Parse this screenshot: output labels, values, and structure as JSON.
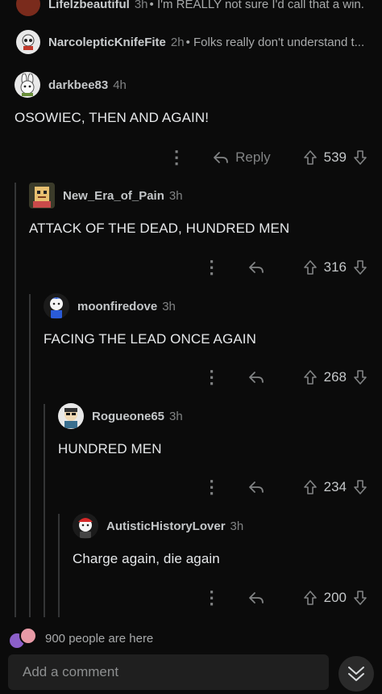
{
  "collapsed": [
    {
      "user": "Lifelzbeautiful",
      "age": "3h",
      "snippet": "• I'm REALLY not sure I'd call that a win."
    },
    {
      "user": "NarcolepticKnifeFite",
      "age": "2h",
      "snippet": "• Folks really don't understand t..."
    }
  ],
  "comments": [
    {
      "user": "darkbee83",
      "age": "4h",
      "body": "OSOWIEC, THEN AND AGAIN!",
      "score": "539",
      "reply_label": "Reply"
    },
    {
      "user": "New_Era_of_Pain",
      "age": "3h",
      "body": "ATTACK OF THE DEAD, HUNDRED MEN",
      "score": "316"
    },
    {
      "user": "moonfiredove",
      "age": "3h",
      "body": "FACING THE LEAD ONCE AGAIN",
      "score": "268"
    },
    {
      "user": "Rogueone65",
      "age": "3h",
      "body": "HUNDRED MEN",
      "score": "234"
    },
    {
      "user": "AutisticHistoryLover",
      "age": "3h",
      "body": "Charge again, die again",
      "score": "200"
    }
  ],
  "presence": {
    "text": "900 people are here"
  },
  "composer": {
    "placeholder": "Add a comment"
  },
  "icons": {
    "upvote": "upvote-arrow-icon",
    "downvote": "downvote-arrow-icon",
    "reply": "reply-arrow-icon",
    "more": "more-dots-icon",
    "jump": "double-chevron-down-icon"
  }
}
